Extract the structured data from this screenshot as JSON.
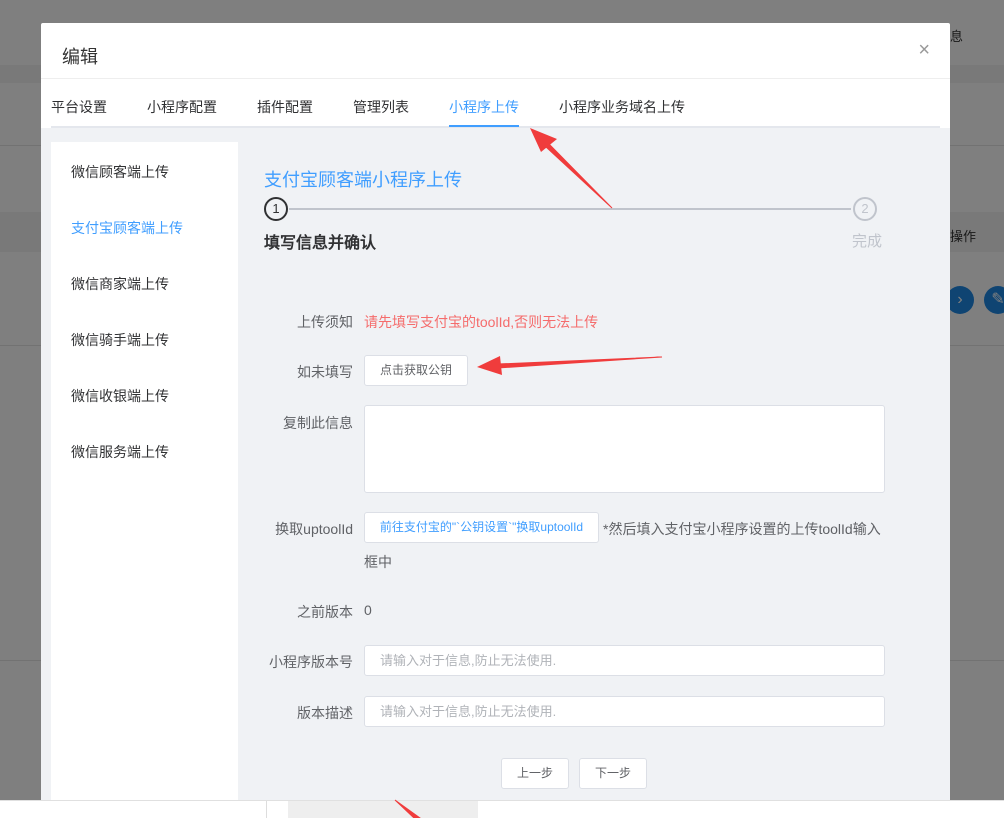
{
  "background": {
    "partial_text_top": "息",
    "partial_text_header": "操作",
    "circle_icons": [
      "chevron-right-icon",
      "edit-icon"
    ]
  },
  "dialog": {
    "title": "编辑",
    "close_label": "×"
  },
  "tabs": [
    {
      "label": "平台设置",
      "active": false
    },
    {
      "label": "小程序配置",
      "active": false
    },
    {
      "label": "插件配置",
      "active": false
    },
    {
      "label": "管理列表",
      "active": false
    },
    {
      "label": "小程序上传",
      "active": true
    },
    {
      "label": "小程序业务域名上传",
      "active": false
    }
  ],
  "sidebar": {
    "items": [
      {
        "label": "微信顾客端上传",
        "active": false
      },
      {
        "label": "支付宝顾客端上传",
        "active": true
      },
      {
        "label": "微信商家端上传",
        "active": false
      },
      {
        "label": "微信骑手端上传",
        "active": false
      },
      {
        "label": "微信收银端上传",
        "active": false
      },
      {
        "label": "微信服务端上传",
        "active": false
      }
    ]
  },
  "section": {
    "title": "支付宝顾客端小程序上传"
  },
  "steps": [
    {
      "number": "1",
      "title": "填写信息并确认",
      "state": "current"
    },
    {
      "number": "2",
      "title": "完成",
      "state": "pending"
    }
  ],
  "form": {
    "notice_label": "上传须知",
    "notice_text": "请先填写支付宝的toolId,否则无法上传",
    "if_not_label": "如未填写",
    "get_key_button": "点击获取公钥",
    "copy_label": "复制此信息",
    "copy_value": "",
    "exchange_label": "换取uptoolId",
    "exchange_button": "前往支付宝的\"`公钥设置`\"换取uptoolId",
    "exchange_note_line1": "*然后填入支付宝小程序设置的上传toolId输入",
    "exchange_note_line2": "框中",
    "prev_version_label": "之前版本",
    "prev_version_value": "0",
    "version_label": "小程序版本号",
    "version_value": "",
    "version_placeholder": "请输入对于信息,防止无法使用.",
    "desc_label": "版本描述",
    "desc_value": "",
    "desc_placeholder": "请输入对于信息,防止无法使用."
  },
  "actions": {
    "prev_button": "上一步",
    "next_button": "下一步"
  },
  "colors": {
    "accent": "#409eff",
    "warning": "#f56c6c",
    "annotation_arrow": "#f03c3c"
  }
}
